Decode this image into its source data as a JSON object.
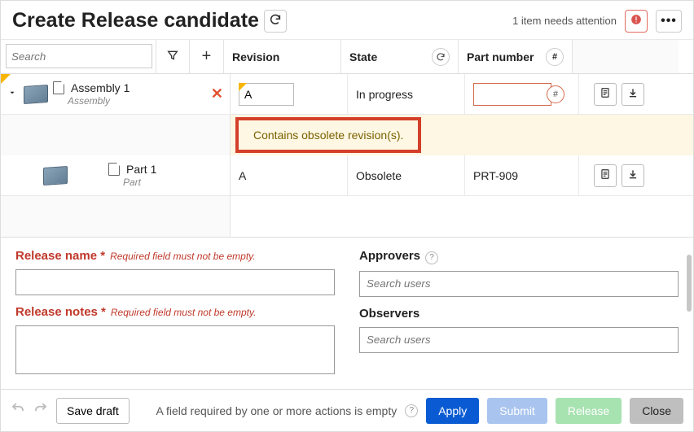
{
  "header": {
    "title": "Create Release candidate",
    "attention": "1 item needs attention"
  },
  "toolbar": {
    "search_placeholder": "Search",
    "col_revision": "Revision",
    "col_state": "State",
    "col_partno": "Part number"
  },
  "rows": [
    {
      "name": "Assembly 1",
      "subtype": "Assembly",
      "revision": "A",
      "state": "In progress",
      "part_number": ""
    },
    {
      "name": "Part 1",
      "subtype": "Part",
      "revision": "A",
      "state": "Obsolete",
      "part_number": "PRT-909"
    }
  ],
  "banner": {
    "message": "Contains obsolete revision(s)."
  },
  "form": {
    "release_name_label": "Release name *",
    "release_name_err": "Required field must not be empty.",
    "release_notes_label": "Release notes *",
    "release_notes_err": "Required field must not be empty.",
    "approvers_label": "Approvers",
    "observers_label": "Observers",
    "search_users_placeholder": "Search users"
  },
  "footer": {
    "save_draft": "Save draft",
    "message": "A field required by one or more actions is empty",
    "apply": "Apply",
    "submit": "Submit",
    "release": "Release",
    "close": "Close"
  }
}
